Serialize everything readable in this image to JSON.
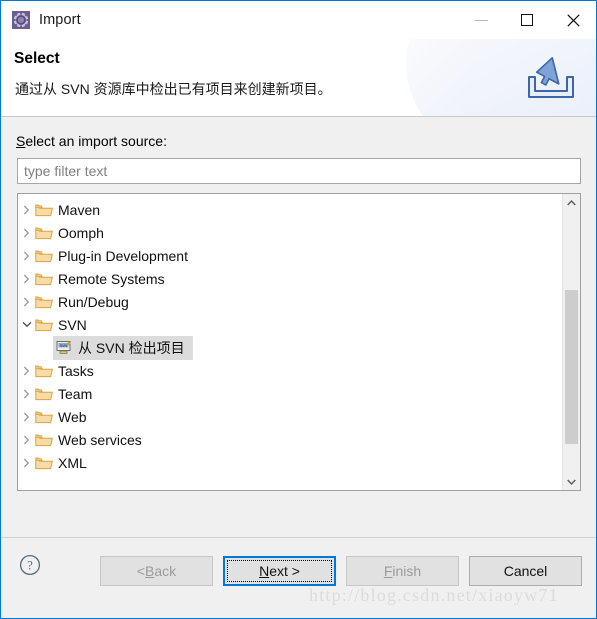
{
  "window": {
    "title": "Import",
    "icon": "eclipse-import-icon",
    "controls": {
      "minimize": "minimize-icon",
      "maximize": "maximize-icon",
      "close": "close-icon"
    }
  },
  "banner": {
    "title": "Select",
    "description": "通过从 SVN 资源库中检出已有项目来创建新项目。",
    "icon": "import-tray-arrow-icon"
  },
  "main": {
    "source_label_mnemonic": "S",
    "source_label_rest": "elect an import source:",
    "filter": {
      "placeholder": "type filter text",
      "value": ""
    },
    "tree": [
      {
        "label": "Maven",
        "expanded": false,
        "type": "folder",
        "selected": false,
        "indent": 0
      },
      {
        "label": "Oomph",
        "expanded": false,
        "type": "folder",
        "selected": false,
        "indent": 0
      },
      {
        "label": "Plug-in Development",
        "expanded": false,
        "type": "folder",
        "selected": false,
        "indent": 0
      },
      {
        "label": "Remote Systems",
        "expanded": false,
        "type": "folder",
        "selected": false,
        "indent": 0
      },
      {
        "label": "Run/Debug",
        "expanded": false,
        "type": "folder",
        "selected": false,
        "indent": 0
      },
      {
        "label": "SVN",
        "expanded": true,
        "type": "folder",
        "selected": false,
        "indent": 0
      },
      {
        "label": "从 SVN 检出项目",
        "expanded": null,
        "type": "svn",
        "selected": true,
        "indent": 1
      },
      {
        "label": "Tasks",
        "expanded": false,
        "type": "folder",
        "selected": false,
        "indent": 0
      },
      {
        "label": "Team",
        "expanded": false,
        "type": "folder",
        "selected": false,
        "indent": 0
      },
      {
        "label": "Web",
        "expanded": false,
        "type": "folder",
        "selected": false,
        "indent": 0
      },
      {
        "label": "Web services",
        "expanded": false,
        "type": "folder",
        "selected": false,
        "indent": 0
      },
      {
        "label": "XML",
        "expanded": false,
        "type": "folder",
        "selected": false,
        "indent": 0
      }
    ],
    "scrollbar": {
      "up_arrow": "chevron-up-icon",
      "down_arrow": "chevron-down-icon"
    }
  },
  "footer": {
    "help_icon": "help-question-icon",
    "buttons": {
      "back": {
        "prefix": "< ",
        "mnemonic": "B",
        "rest": "ack",
        "disabled": true,
        "default": false
      },
      "next": {
        "prefix": "",
        "mnemonic": "N",
        "rest": "ext >",
        "disabled": false,
        "default": true
      },
      "finish": {
        "prefix": "",
        "mnemonic": "F",
        "rest": "inish",
        "disabled": true,
        "default": false
      },
      "cancel": {
        "prefix": "",
        "mnemonic": "",
        "rest": "Cancel",
        "disabled": false,
        "default": false
      }
    }
  },
  "watermark": {
    "text": "http://blog.csdn.net/xiaoyw71"
  },
  "colors": {
    "accent": "#0078d7",
    "window_bg": "#f0f0f0",
    "selection": "#dcdcdc",
    "folder": "#e8b96a"
  }
}
